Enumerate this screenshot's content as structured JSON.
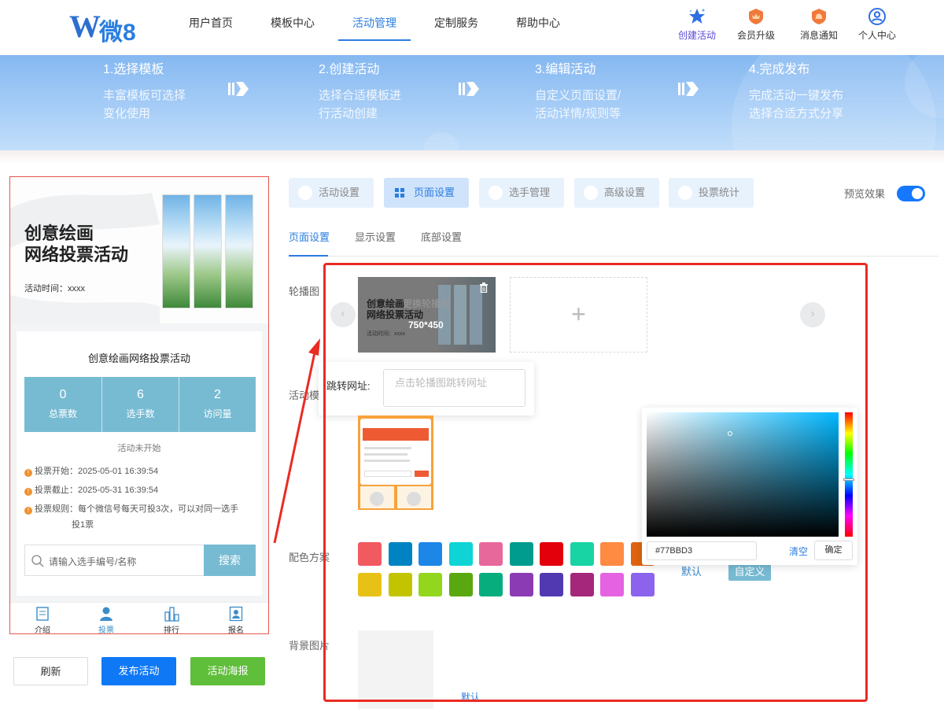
{
  "header": {
    "logo_text": "微8",
    "nav": [
      {
        "label": "用户首页"
      },
      {
        "label": "模板中心"
      },
      {
        "label": "活动管理"
      },
      {
        "label": "定制服务"
      },
      {
        "label": "帮助中心"
      }
    ],
    "actions": [
      {
        "label": "创建活动",
        "icon": "star-icon"
      },
      {
        "label": "会员升级",
        "icon": "crown-badge-icon"
      },
      {
        "label": "消息通知",
        "icon": "bell-badge-icon"
      },
      {
        "label": "个人中心",
        "icon": "user-icon"
      }
    ]
  },
  "steps": [
    {
      "title": "1.选择模板",
      "line1": "丰富模板可选择",
      "line2": "变化使用"
    },
    {
      "title": "2.创建活动",
      "line1": "选择合适模板进",
      "line2": "行活动创建"
    },
    {
      "title": "3.编辑活动",
      "line1": "自定义页面设置/",
      "line2": "活动详情/规则等"
    },
    {
      "title": "4.完成发布",
      "line1": "完成活动一键发布",
      "line2": "选择合适方式分享"
    }
  ],
  "preview": {
    "banner_title_line1": "创意绘画",
    "banner_title_line2": "网络投票活动",
    "banner_time": "活动时间：xxxx",
    "card_title": "创意绘画网络投票活动",
    "stats": [
      {
        "value": "0",
        "label": "总票数"
      },
      {
        "value": "6",
        "label": "选手数"
      },
      {
        "value": "2",
        "label": "访问量"
      }
    ],
    "status": "活动未开始",
    "info": [
      {
        "label": "投票开始：",
        "value": "2025-05-01 16:39:54"
      },
      {
        "label": "投票截止：",
        "value": "2025-05-31 16:39:54"
      },
      {
        "label": "投票规则：",
        "value": "每个微信号每天可投3次，可以对同一选手",
        "value2": "投1票"
      }
    ],
    "search_placeholder": "请输入选手编号/名称",
    "search_button": "搜索",
    "tabs": [
      {
        "label": "介绍",
        "icon": "intro-icon"
      },
      {
        "label": "投票",
        "icon": "vote-user-icon"
      },
      {
        "label": "排行",
        "icon": "ranking-icon"
      },
      {
        "label": "报名",
        "icon": "signup-icon"
      }
    ],
    "theme_color": "#77BBD3"
  },
  "bottom_buttons": {
    "refresh": "刷新",
    "publish": "发布活动",
    "poster": "活动海报"
  },
  "settings": {
    "tabs": [
      {
        "label": "活动设置"
      },
      {
        "label": "页面设置"
      },
      {
        "label": "选手管理"
      },
      {
        "label": "高级设置"
      },
      {
        "label": "投票统计"
      }
    ],
    "preview_toggle_label": "预览效果",
    "preview_toggle_on": true,
    "sub_tabs": [
      {
        "label": "页面设置"
      },
      {
        "label": "显示设置"
      },
      {
        "label": "底部设置"
      }
    ],
    "rows": {
      "carousel": "轮播图",
      "template": "活动模",
      "color_scheme": "配色方案",
      "background": "背景图片"
    },
    "carousel": {
      "change_label": "更换轮播图",
      "size_label": "750*450",
      "thumb_title_line1": "创意绘画",
      "thumb_title_line2": "网络投票活动",
      "thumb_time": "活动时间：xxxx",
      "url_label": "跳转网址:",
      "url_placeholder": "点击轮播图跳转网址"
    },
    "color_scheme": {
      "swatches_row1": [
        "#f15a5f",
        "#0083c2",
        "#1d87e8",
        "#0ed4d6",
        "#e7699b",
        "#009c8e",
        "#e3000b",
        "#18d3a3",
        "#ff8a42",
        "#e0630f"
      ],
      "swatches_row2": [
        "#e8c116",
        "#c3c400",
        "#93d61d",
        "#5aa80f",
        "#08ad7e",
        "#8b3bb3",
        "#5139b2",
        "#a5277b",
        "#e563e3",
        "#8c63ed"
      ],
      "default_label": "默认",
      "custom_label": "自定义"
    },
    "picker": {
      "hex_value": "#77BBD3",
      "clear_label": "清空",
      "confirm_label": "确定"
    },
    "background": {
      "default_label": "默认"
    }
  }
}
